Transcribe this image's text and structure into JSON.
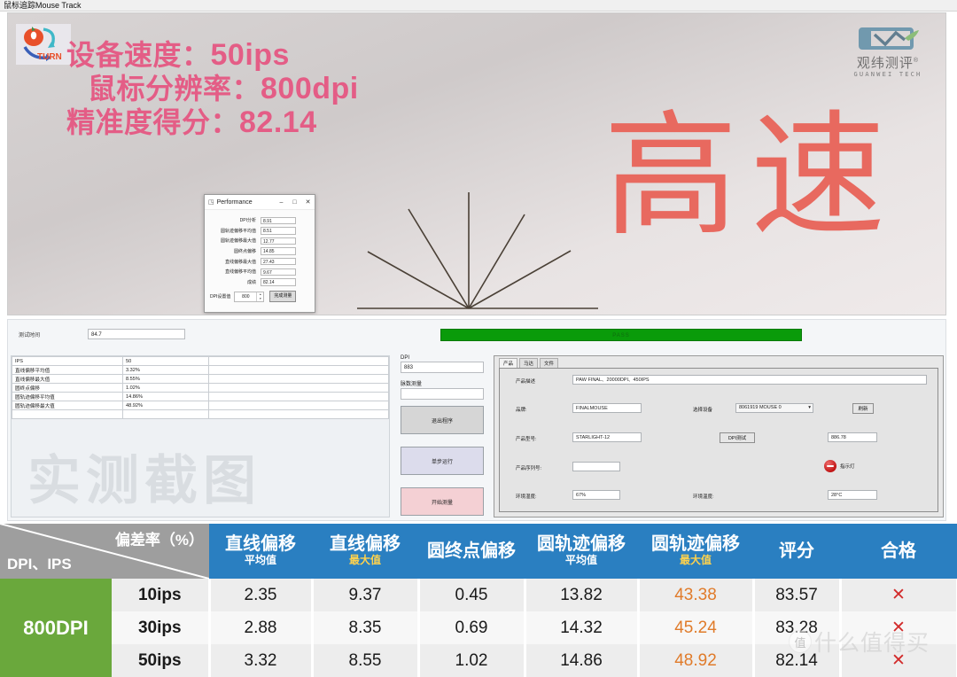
{
  "window": {
    "title": "鼠标追踪Mouse Track"
  },
  "track_panel": {
    "logo_text": "TURN",
    "headlines": [
      {
        "label": "设备速度：",
        "value": "50ips"
      },
      {
        "label": "鼠标分辨率：",
        "value": "800dpi"
      },
      {
        "label": "精准度得分：",
        "value": "82.14"
      }
    ],
    "watermark": "高速",
    "brand": {
      "cn": "观纬测评",
      "reg": "®",
      "en": "GUANWEI TECH"
    }
  },
  "performance_dialog": {
    "title": "Performance",
    "minimize": "–",
    "maximize": "□",
    "close": "✕",
    "rows": [
      {
        "label": "DPI分析",
        "value": "8.91"
      },
      {
        "label": "圆轨迹偏移平均值",
        "value": "8.51"
      },
      {
        "label": "圆轨迹偏移最大值",
        "value": "12.77"
      },
      {
        "label": "圆终点偏移",
        "value": "14.85"
      },
      {
        "label": "直线偏移最大值",
        "value": "27.43"
      },
      {
        "label": "直线偏移平均值",
        "value": "9.67"
      },
      {
        "label": "成绩",
        "value": "82.14"
      }
    ],
    "footer": {
      "label": "DPI设置值",
      "value": "800",
      "button": "完成测量"
    }
  },
  "middle": {
    "time_label": "测试时间",
    "time_value": "84.7",
    "progress_text": "PASS",
    "result_table": [
      {
        "k": "IPS",
        "v": "50"
      },
      {
        "k": "直线偏移平均值",
        "v": "3.32%"
      },
      {
        "k": "直线偏移最大值",
        "v": "8.55%"
      },
      {
        "k": "圆终点偏移",
        "v": "1.02%"
      },
      {
        "k": "圆轨迹偏移平均值",
        "v": "14.86%"
      },
      {
        "k": "圆轨迹偏移最大值",
        "v": "48.92%"
      }
    ],
    "result_watermark": "实测截图",
    "dpi_label": "DPI",
    "dpi_value": "883",
    "pulse_label": "脉数测量",
    "pulse_value": "",
    "buttons": {
      "exit": "退出程序",
      "step": "单步运行",
      "start": "开始测量"
    }
  },
  "product_panel": {
    "tabs": [
      {
        "label": "产品",
        "active": true
      },
      {
        "label": "马达",
        "active": false
      },
      {
        "label": "文件",
        "active": false
      }
    ],
    "fields": [
      {
        "label": "产品描述",
        "value": "PAW FINAL、20000DPI、450IPS"
      },
      {
        "label": "品牌:",
        "value": "FINALMOUSE"
      },
      {
        "label": "产品型号:",
        "value": "STARLIGHT-12"
      },
      {
        "label": "产品序列号:",
        "value": ""
      },
      {
        "label": "环境湿度:",
        "value": "67%"
      }
    ],
    "device_select_label": "选择设备",
    "device_select_value": "8061919  MOUSE  0",
    "refresh_button": "刷新",
    "dpi_test_button": "DPI测试",
    "dpi_test_value": "886.78",
    "indicator_label": "指示灯",
    "temp_label": "环境温度:",
    "temp_value": "28°C"
  },
  "summary_table": {
    "corner_top": "偏差率（%）",
    "corner_bottom": "DPI、IPS",
    "columns": [
      {
        "t1": "直线偏移",
        "t2": "平均值",
        "highlight": false
      },
      {
        "t1": "直线偏移",
        "t2": "最大值",
        "highlight": true
      },
      {
        "t1": "圆终点偏移",
        "t2": "",
        "highlight": false
      },
      {
        "t1": "圆轨迹偏移",
        "t2": "平均值",
        "highlight": false
      },
      {
        "t1": "圆轨迹偏移",
        "t2": "最大值",
        "highlight": true
      },
      {
        "t1": "评分",
        "t2": "",
        "highlight": false
      },
      {
        "t1": "合格",
        "t2": "",
        "highlight": false
      }
    ],
    "group_label": "800DPI",
    "rows": [
      {
        "ips": "10ips",
        "line_avg": "2.35",
        "line_max": "9.37",
        "circle_end": "0.45",
        "circle_avg": "13.82",
        "circle_max": "43.38",
        "score": "83.57",
        "pass": "✕"
      },
      {
        "ips": "30ips",
        "line_avg": "2.88",
        "line_max": "8.35",
        "circle_end": "0.69",
        "circle_avg": "14.32",
        "circle_max": "45.24",
        "score": "83.28",
        "pass": "✕"
      },
      {
        "ips": "50ips",
        "line_avg": "3.32",
        "line_max": "8.55",
        "circle_end": "1.02",
        "circle_avg": "14.86",
        "circle_max": "48.92",
        "score": "82.14",
        "pass": "✕"
      }
    ]
  },
  "watermark": {
    "site": "什么值得买",
    "badge": "值"
  },
  "colors": {
    "header_blue": "#2a7fc1",
    "group_green": "#6aa83c",
    "orange": "#e07b2a",
    "pink": "#e45d86",
    "red_mark": "#e8695f",
    "pass_green": "#0a9b0a"
  }
}
